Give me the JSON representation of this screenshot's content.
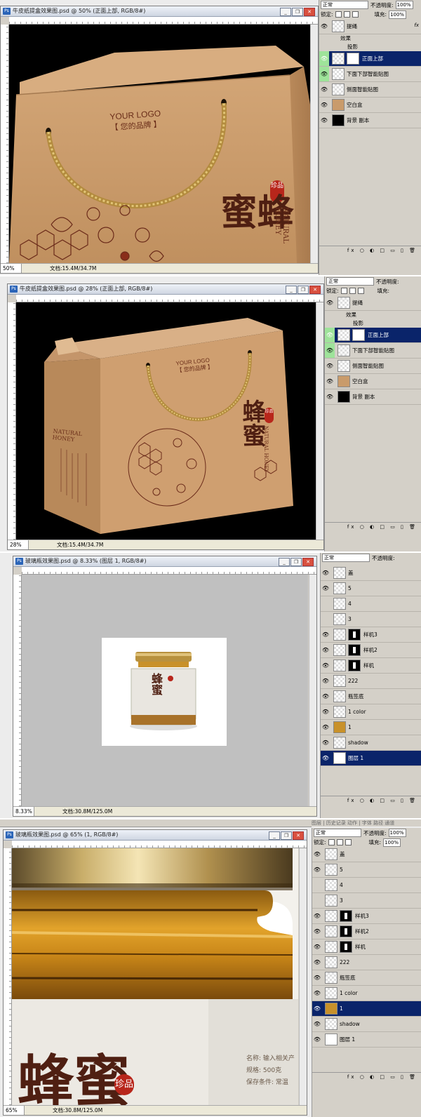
{
  "ui_labels": {
    "blend_mode": "正常",
    "opacity_label": "不透明度:",
    "opacity_value": "100%",
    "lock_label": "锁定:",
    "fill_label": "填充:",
    "fill_value": "100%",
    "fx_label": "fx",
    "panel_tabs": "图层 | 历史记录 动作 | 字体 路径 通道",
    "bottom_icons": "fx ○ ◐ □ ▭ ▯ 🗑"
  },
  "artwork": {
    "logo_line1": "YOUR LOGO",
    "logo_line2": "【 您的品牌 】",
    "seal_text": "珍品",
    "brand_cn": "蜂蜜",
    "brand_en": "NATURAL HONEY",
    "jar_label_name": "名称: 输入相关产",
    "jar_label_spec": "规格: 500克",
    "jar_label_store": "保存条件: 常温"
  },
  "shot1": {
    "title": "牛皮纸提盒效果图.psd @ 50% (正面上部, RGB/8#)",
    "zoom": "50%",
    "doc_info": "文档:15.4M/34.7M",
    "ruler_marks": [
      "5",
      "10",
      "15",
      "20",
      "25",
      "30",
      "35"
    ],
    "layers": [
      {
        "name": "提绳",
        "fx": true,
        "thumb": "checker"
      },
      {
        "name": "正面上部",
        "selected": true,
        "thumb": "checker",
        "mask": "white"
      },
      {
        "name": "下面下部智能贴图",
        "thumb": "checker"
      },
      {
        "name": "侧面智能贴图",
        "thumb": "checker"
      },
      {
        "name": "空白盒",
        "thumb": "kraft"
      },
      {
        "name": "背景 副本",
        "thumb": "black"
      }
    ],
    "effects_label": "效果",
    "shadow_label": "投影"
  },
  "shot2": {
    "title": "牛皮纸提盒效果图.psd @ 28% (正面上部, RGB/8#)",
    "zoom": "28%",
    "doc_info": "文档:15.4M/34.7M",
    "ruler_marks": [
      "0",
      "5",
      "10",
      "15",
      "20",
      "25",
      "30",
      "35",
      "40",
      "45",
      "50",
      "55",
      "60",
      "65",
      "70"
    ],
    "layers": [
      {
        "name": "提绳",
        "thumb": "checker"
      },
      {
        "name": "正面上部",
        "selected": true,
        "thumb": "checker",
        "mask": "white"
      },
      {
        "name": "下面下部智能贴图",
        "thumb": "checker"
      },
      {
        "name": "侧面智能贴图",
        "thumb": "checker"
      },
      {
        "name": "空白盒",
        "thumb": "kraft"
      },
      {
        "name": "背景 副本",
        "thumb": "black"
      }
    ],
    "effects_label": "效果",
    "shadow_label": "投影"
  },
  "shot3": {
    "title": "玻璃瓶效果图.psd @ 8.33% (图层 1, RGB/8#)",
    "zoom": "8.33%",
    "doc_info": "文档:30.8M/125.0M",
    "ruler_marks": [
      "0",
      "5",
      "10",
      "15",
      "20",
      "25",
      "30",
      "35",
      "40",
      "45",
      "50",
      "55",
      "60",
      "65"
    ],
    "layers": [
      {
        "name": "盖",
        "thumb": "checker"
      },
      {
        "name": "5",
        "thumb": "checker"
      },
      {
        "name": "4",
        "thumb": "checker"
      },
      {
        "name": "3",
        "thumb": "checker"
      },
      {
        "name": "样机3",
        "thumb": "checker",
        "mask": "black"
      },
      {
        "name": "样机2",
        "thumb": "checker",
        "mask": "black"
      },
      {
        "name": "样机",
        "thumb": "checker",
        "mask": "black"
      },
      {
        "name": "222",
        "thumb": "checker"
      },
      {
        "name": "瓶签底",
        "thumb": "checker"
      },
      {
        "name": "1 color",
        "thumb": "checker"
      },
      {
        "name": "1",
        "thumb": "jar"
      },
      {
        "name": "shadow",
        "thumb": "checker"
      },
      {
        "name": "图层 1",
        "selected": true,
        "thumb": "white"
      }
    ]
  },
  "shot4": {
    "title": "玻璃瓶效果图.psd @ 65% (1, RGB/8#)",
    "zoom": "65%",
    "doc_info": "文档:30.8M/125.0M",
    "ruler_marks": [
      "14",
      "15",
      "16",
      "17",
      "18",
      "19"
    ],
    "layers": [
      {
        "name": "盖",
        "thumb": "checker"
      },
      {
        "name": "5",
        "thumb": "checker"
      },
      {
        "name": "4",
        "thumb": "checker"
      },
      {
        "name": "3",
        "thumb": "checker"
      },
      {
        "name": "样机3",
        "thumb": "checker",
        "mask": "black"
      },
      {
        "name": "样机2",
        "thumb": "checker",
        "mask": "black"
      },
      {
        "name": "样机",
        "thumb": "checker",
        "mask": "black"
      },
      {
        "name": "222",
        "thumb": "checker"
      },
      {
        "name": "瓶签底",
        "thumb": "checker"
      },
      {
        "name": "1 color",
        "thumb": "checker"
      },
      {
        "name": "1",
        "selected": true,
        "thumb": "jar"
      },
      {
        "name": "shadow",
        "thumb": "checker"
      },
      {
        "name": "图层 1",
        "thumb": "white"
      }
    ]
  },
  "colors": {
    "kraft": "#c99b6b",
    "ink": "#5a2716",
    "selection": "#0a246a",
    "seal": "#b8261b",
    "gold": "#c9a24a"
  }
}
